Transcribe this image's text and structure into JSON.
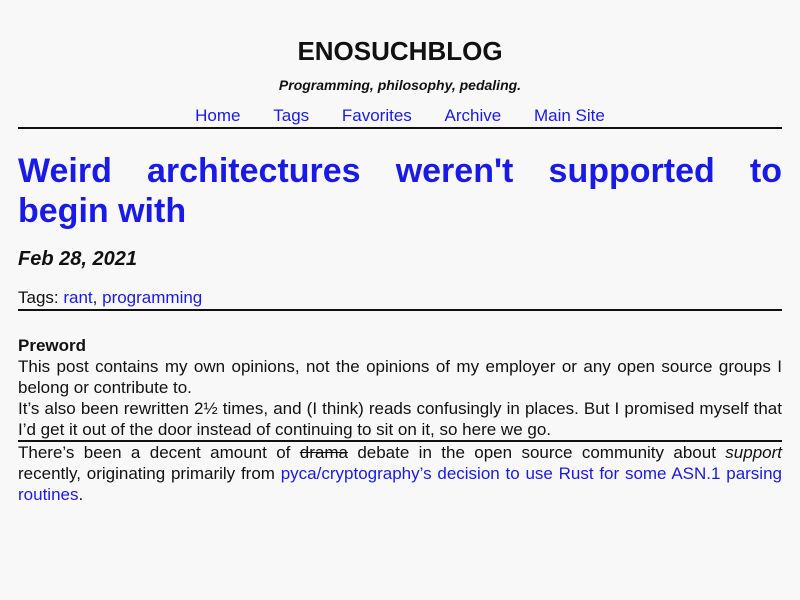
{
  "site": {
    "title": "ENOSUCHBLOG",
    "tagline": "Programming, philosophy, pedaling."
  },
  "nav": {
    "items": [
      "Home",
      "Tags",
      "Favorites",
      "Archive",
      "Main Site"
    ]
  },
  "post": {
    "title_words_line1": [
      "Weird",
      "architectures",
      "weren't",
      "supported",
      "to"
    ],
    "title_line2": "begin with",
    "date": "Feb 28, 2021",
    "tags_label": "Tags: ",
    "tags": [
      "rant",
      "programming"
    ],
    "tag_separator": ", "
  },
  "content": {
    "preword_heading": "Preword",
    "paragraph1": "This post contains my own opinions, not the opinions of my employer or any open source groups I belong or contribute to.",
    "paragraph2": "It’s also been rewritten 2½ times, and (I think) reads confusingly in places. But I promised myself that I’d get it out of the door instead of continuing to sit on it, so here we go.",
    "paragraph3_start": "There’s been a decent amount of ",
    "paragraph3_strike": "drama",
    "paragraph3_mid": " debate in the open source community about ",
    "paragraph3_em": "support",
    "paragraph3_after_em": " recently, originating primarily from ",
    "paragraph3_link": "pyca/cryptography’s decision to use Rust for some ASN.1 parsing routines",
    "paragraph3_end": "."
  }
}
